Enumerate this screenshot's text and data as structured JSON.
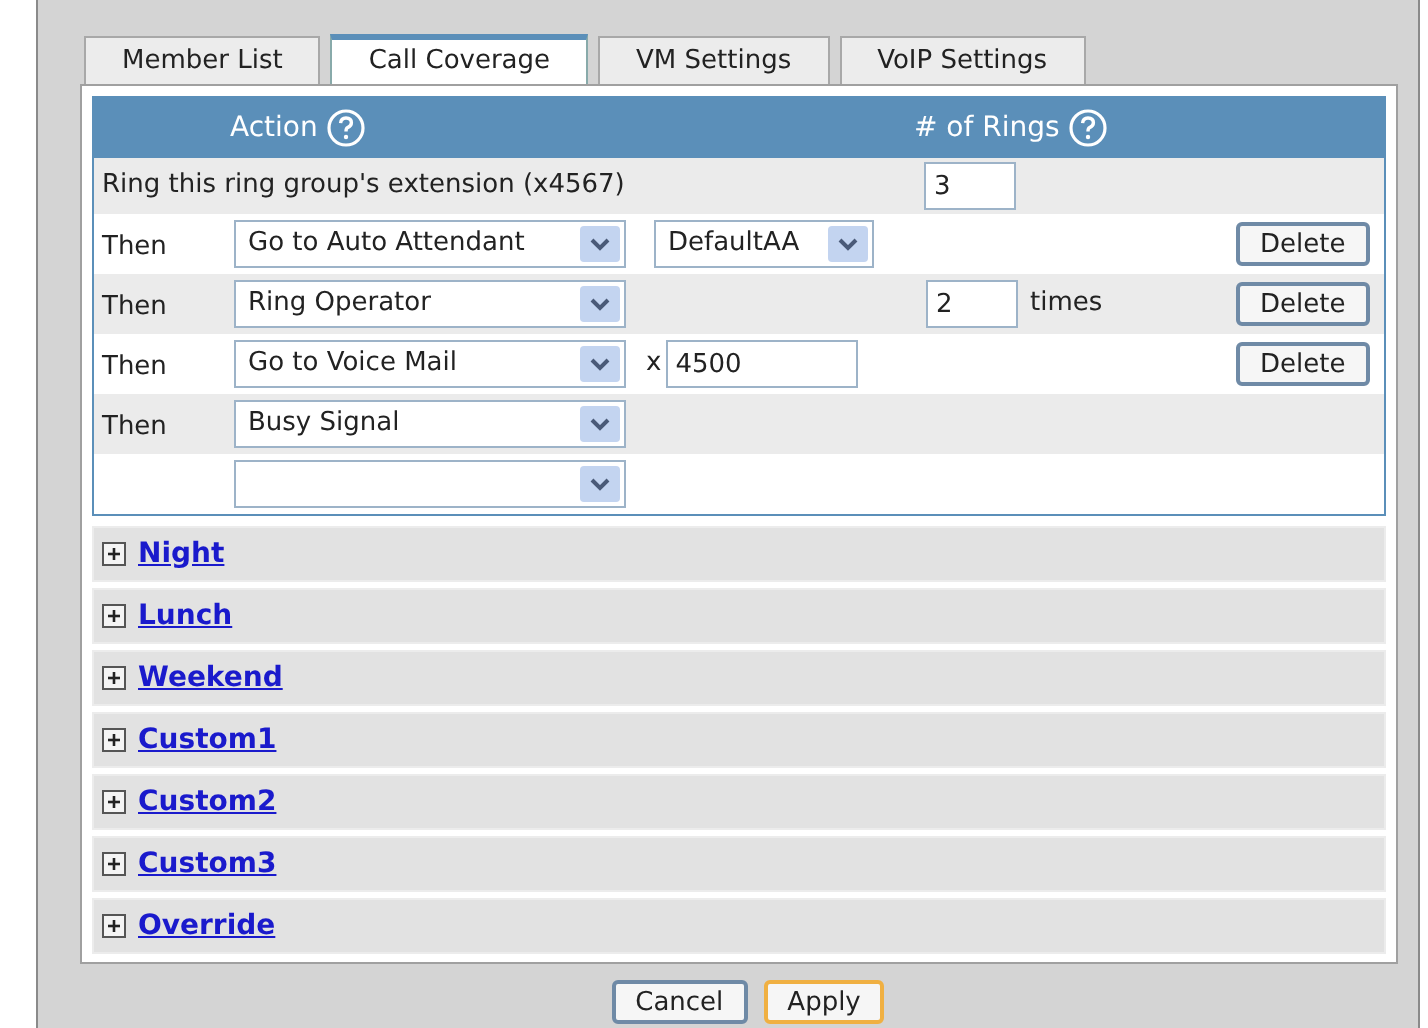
{
  "tabs": [
    {
      "label": "Member List",
      "selected": false
    },
    {
      "label": "Call Coverage",
      "selected": true
    },
    {
      "label": "VM Settings",
      "selected": false
    },
    {
      "label": "VoIP Settings",
      "selected": false
    }
  ],
  "columns": [
    "Action",
    "# of Rings"
  ],
  "ring_row": {
    "label": "Ring this ring group's extension (x4567)",
    "rings": "3"
  },
  "steps": [
    {
      "prefix": "Then",
      "action": "Go to Auto Attendant",
      "target": "DefaultAA",
      "delete": "Delete"
    },
    {
      "prefix": "Then",
      "action": "Ring Operator",
      "rings": "2",
      "rings_suffix": "times",
      "delete": "Delete"
    },
    {
      "prefix": "Then",
      "action": "Go to Voice Mail",
      "extension_prefix": "x",
      "extension": "4500",
      "delete": "Delete"
    },
    {
      "prefix": "Then",
      "action": "Busy Signal"
    },
    {
      "kind": "new"
    }
  ],
  "sections": [
    {
      "label": "Night",
      "expanded": false
    },
    {
      "label": "Lunch",
      "expanded": false
    },
    {
      "label": "Weekend",
      "expanded": false
    },
    {
      "label": "Custom1",
      "expanded": false
    },
    {
      "label": "Custom2",
      "expanded": false
    },
    {
      "label": "Custom3",
      "expanded": false
    },
    {
      "label": "Override",
      "expanded": false
    }
  ],
  "buttons": [
    {
      "label": "Cancel",
      "highlighted": false
    },
    {
      "label": "Apply",
      "highlighted": true
    }
  ]
}
